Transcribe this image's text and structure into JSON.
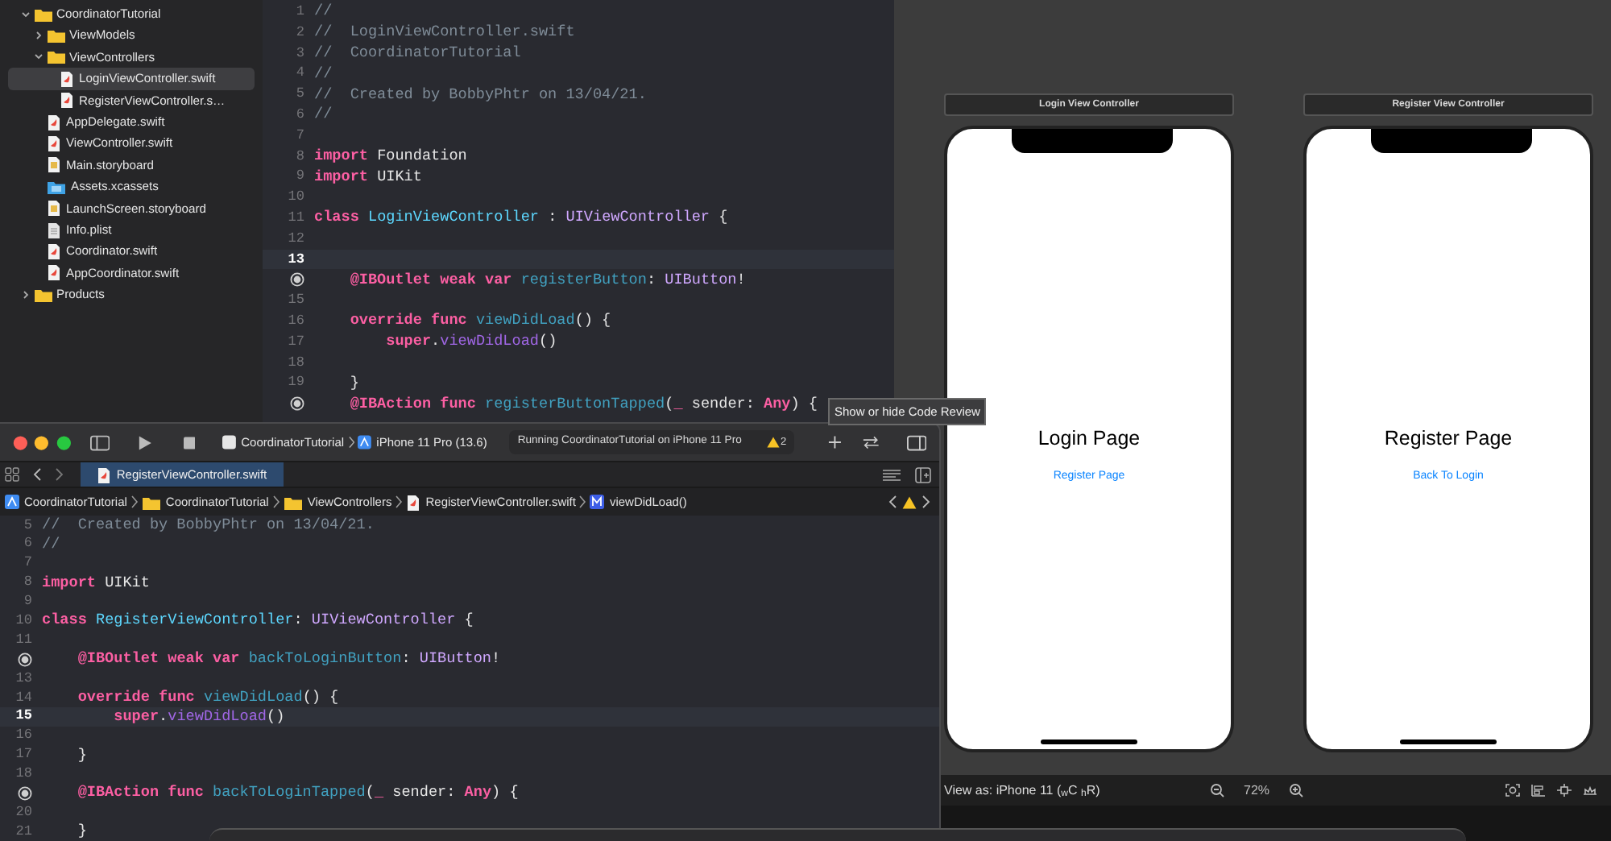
{
  "navigator": {
    "items": [
      {
        "label": "CoordinatorTutorial",
        "kind": "folder",
        "expanded": true,
        "selected": false,
        "children": [
          {
            "label": "ViewModels",
            "kind": "folder",
            "expanded": false,
            "selected": false
          },
          {
            "label": "ViewControllers",
            "kind": "folder",
            "expanded": true,
            "selected": false,
            "children": [
              {
                "label": "LoginViewController.swift",
                "kind": "swift",
                "selected": true
              },
              {
                "label": "RegisterViewController.s…",
                "kind": "swift",
                "selected": false
              }
            ]
          },
          {
            "label": "AppDelegate.swift",
            "kind": "swift",
            "selected": false
          },
          {
            "label": "ViewController.swift",
            "kind": "swift",
            "selected": false
          },
          {
            "label": "Main.storyboard",
            "kind": "storyboard",
            "selected": false
          },
          {
            "label": "Assets.xcassets",
            "kind": "assets",
            "selected": false
          },
          {
            "label": "LaunchScreen.storyboard",
            "kind": "storyboard",
            "selected": false
          },
          {
            "label": "Info.plist",
            "kind": "plist",
            "selected": false
          },
          {
            "label": "Coordinator.swift",
            "kind": "swift",
            "selected": false
          },
          {
            "label": "AppCoordinator.swift",
            "kind": "swift",
            "selected": false
          }
        ]
      },
      {
        "label": "Products",
        "kind": "folder",
        "expanded": false,
        "selected": false
      }
    ]
  },
  "editor": {
    "lines": [
      {
        "number": "1",
        "connection": false,
        "current": false,
        "tokens": [
          {
            "kind": "comment",
            "text": "//"
          }
        ]
      },
      {
        "number": "2",
        "connection": false,
        "current": false,
        "tokens": [
          {
            "kind": "comment",
            "text": "//  LoginViewController.swift"
          }
        ]
      },
      {
        "number": "3",
        "connection": false,
        "current": false,
        "tokens": [
          {
            "kind": "comment",
            "text": "//  CoordinatorTutorial"
          }
        ]
      },
      {
        "number": "4",
        "connection": false,
        "current": false,
        "tokens": [
          {
            "kind": "comment",
            "text": "//"
          }
        ]
      },
      {
        "number": "5",
        "connection": false,
        "current": false,
        "tokens": [
          {
            "kind": "comment",
            "text": "//  Created by BobbyPhtr on 13/04/21."
          }
        ]
      },
      {
        "number": "6",
        "connection": false,
        "current": false,
        "tokens": [
          {
            "kind": "comment",
            "text": "//"
          }
        ]
      },
      {
        "number": "7",
        "connection": false,
        "current": false
      },
      {
        "number": "8",
        "connection": false,
        "current": false,
        "tokens": [
          {
            "kind": "keyword",
            "text": "import"
          },
          {
            "kind": "plain",
            "text": " Foundation"
          }
        ]
      },
      {
        "number": "9",
        "connection": false,
        "current": false,
        "tokens": [
          {
            "kind": "keyword",
            "text": "import"
          },
          {
            "kind": "plain",
            "text": " UIKit"
          }
        ]
      },
      {
        "number": "10",
        "connection": false,
        "current": false
      },
      {
        "number": "11",
        "connection": false,
        "current": false,
        "tokens": [
          {
            "kind": "keyword",
            "text": "class"
          },
          {
            "kind": "declaration",
            "text": " LoginViewController"
          },
          {
            "kind": "plain",
            "text": " : "
          },
          {
            "kind": "type",
            "text": "UIViewController"
          },
          {
            "kind": "plain",
            "text": " {"
          }
        ]
      },
      {
        "number": "12",
        "connection": false,
        "current": false
      },
      {
        "number": "13",
        "connection": false,
        "current": true
      },
      {
        "connection": true,
        "current": false,
        "tokens": [
          {
            "kind": "keyword",
            "text": "    @IBOutlet"
          },
          {
            "kind": "keyword",
            "text": " weak"
          },
          {
            "kind": "keyword",
            "text": " var"
          },
          {
            "kind": "project",
            "text": " registerButton"
          },
          {
            "kind": "plain",
            "text": ": "
          },
          {
            "kind": "type",
            "text": "UIButton"
          },
          {
            "kind": "plain",
            "text": "!"
          }
        ]
      },
      {
        "number": "15",
        "connection": false,
        "current": false
      },
      {
        "number": "16",
        "connection": false,
        "current": false,
        "tokens": [
          {
            "kind": "keyword",
            "text": "    override"
          },
          {
            "kind": "keyword",
            "text": " func"
          },
          {
            "kind": "project",
            "text": " viewDidLoad"
          },
          {
            "kind": "plain",
            "text": "() {"
          }
        ]
      },
      {
        "number": "17",
        "connection": false,
        "current": false,
        "tokens": [
          {
            "kind": "keyword",
            "text": "        super"
          },
          {
            "kind": "plain",
            "text": "."
          },
          {
            "kind": "method",
            "text": "viewDidLoad"
          },
          {
            "kind": "plain",
            "text": "()"
          }
        ]
      },
      {
        "number": "18",
        "connection": false,
        "current": false
      },
      {
        "number": "19",
        "connection": false,
        "current": false,
        "tokens": [
          {
            "kind": "plain",
            "text": "    }"
          }
        ]
      },
      {
        "connection": true,
        "current": false,
        "tokens": [
          {
            "kind": "keyword",
            "text": "    @IBAction"
          },
          {
            "kind": "keyword",
            "text": " func"
          },
          {
            "kind": "project",
            "text": " registerButtonTapped"
          },
          {
            "kind": "plain",
            "text": "("
          },
          {
            "kind": "keyword",
            "text": "_"
          },
          {
            "kind": "plain",
            "text": " sender: "
          },
          {
            "kind": "keyword",
            "text": "Any"
          },
          {
            "kind": "plain",
            "text": ") {"
          }
        ]
      }
    ]
  },
  "tooltip": "Show or hide Code Review",
  "canvas": {
    "scenes": [
      {
        "title": "Login View Controller",
        "heading": "Login Page",
        "link": "Register Page"
      },
      {
        "title": "Register View Controller",
        "heading": "Register Page",
        "link": "Back To Login"
      }
    ],
    "view_as": "View as: iPhone 11 ($_{w}$C $_{h}$R)",
    "zoom": "72%"
  },
  "second_window": {
    "toolbar": {
      "scheme": "CoordinatorTutorial",
      "device": "iPhone 11 Pro (13.6)",
      "activity": "Running CoordinatorTutorial on iPhone 11 Pro",
      "warnings": "2"
    },
    "tabs": [
      {
        "label": "RegisterViewController.swift",
        "selected": true
      }
    ],
    "jump_bar": [
      {
        "label": "CoordinatorTutorial",
        "kind": "project"
      },
      {
        "label": "CoordinatorTutorial",
        "kind": "folder"
      },
      {
        "label": "ViewControllers",
        "kind": "folder"
      },
      {
        "label": "RegisterViewController.swift",
        "kind": "swift"
      },
      {
        "label": "viewDidLoad()",
        "kind": "method"
      }
    ],
    "lines": [
      {
        "number": "5",
        "connection": false,
        "current": false,
        "tokens": [
          {
            "kind": "comment",
            "text": "//  Created by BobbyPhtr on 13/04/21."
          }
        ]
      },
      {
        "number": "6",
        "connection": false,
        "current": false,
        "tokens": [
          {
            "kind": "comment",
            "text": "//"
          }
        ]
      },
      {
        "number": "7",
        "connection": false,
        "current": false
      },
      {
        "number": "8",
        "connection": false,
        "current": false,
        "tokens": [
          {
            "kind": "keyword",
            "text": "import"
          },
          {
            "kind": "plain",
            "text": " UIKit"
          }
        ]
      },
      {
        "number": "9",
        "connection": false,
        "current": false
      },
      {
        "number": "10",
        "connection": false,
        "current": false,
        "tokens": [
          {
            "kind": "keyword",
            "text": "class"
          },
          {
            "kind": "declaration",
            "text": " RegisterViewController"
          },
          {
            "kind": "plain",
            "text": ": "
          },
          {
            "kind": "type",
            "text": "UIViewController"
          },
          {
            "kind": "plain",
            "text": " {"
          }
        ]
      },
      {
        "number": "11",
        "connection": false,
        "current": false
      },
      {
        "connection": true,
        "current": false,
        "tokens": [
          {
            "kind": "keyword",
            "text": "    @IBOutlet"
          },
          {
            "kind": "keyword",
            "text": " weak"
          },
          {
            "kind": "keyword",
            "text": " var"
          },
          {
            "kind": "project",
            "text": " backToLoginButton"
          },
          {
            "kind": "plain",
            "text": ": "
          },
          {
            "kind": "type",
            "text": "UIButton"
          },
          {
            "kind": "plain",
            "text": "!"
          }
        ]
      },
      {
        "number": "13",
        "connection": false,
        "current": false
      },
      {
        "number": "14",
        "connection": false,
        "current": false,
        "tokens": [
          {
            "kind": "keyword",
            "text": "    override"
          },
          {
            "kind": "keyword",
            "text": " func"
          },
          {
            "kind": "project",
            "text": " viewDidLoad"
          },
          {
            "kind": "plain",
            "text": "() {"
          }
        ]
      },
      {
        "number": "15",
        "connection": false,
        "current": true,
        "tokens": [
          {
            "kind": "keyword",
            "text": "        super"
          },
          {
            "kind": "plain",
            "text": "."
          },
          {
            "kind": "method",
            "text": "viewDidLoad"
          },
          {
            "kind": "plain",
            "text": "()"
          }
        ]
      },
      {
        "number": "16",
        "connection": false,
        "current": false
      },
      {
        "number": "17",
        "connection": false,
        "current": false,
        "tokens": [
          {
            "kind": "plain",
            "text": "    }"
          }
        ]
      },
      {
        "number": "18",
        "connection": false,
        "current": false
      },
      {
        "connection": true,
        "current": false,
        "tokens": [
          {
            "kind": "keyword",
            "text": "    @IBAction"
          },
          {
            "kind": "keyword",
            "text": " func"
          },
          {
            "kind": "project",
            "text": " backToLoginTapped"
          },
          {
            "kind": "plain",
            "text": "("
          },
          {
            "kind": "keyword",
            "text": "_"
          },
          {
            "kind": "plain",
            "text": " sender: "
          },
          {
            "kind": "keyword",
            "text": "Any"
          },
          {
            "kind": "plain",
            "text": ") {"
          }
        ]
      },
      {
        "number": "20",
        "connection": false,
        "current": false
      },
      {
        "number": "21",
        "connection": false,
        "current": false,
        "tokens": [
          {
            "kind": "plain",
            "text": "    }"
          }
        ]
      }
    ]
  }
}
